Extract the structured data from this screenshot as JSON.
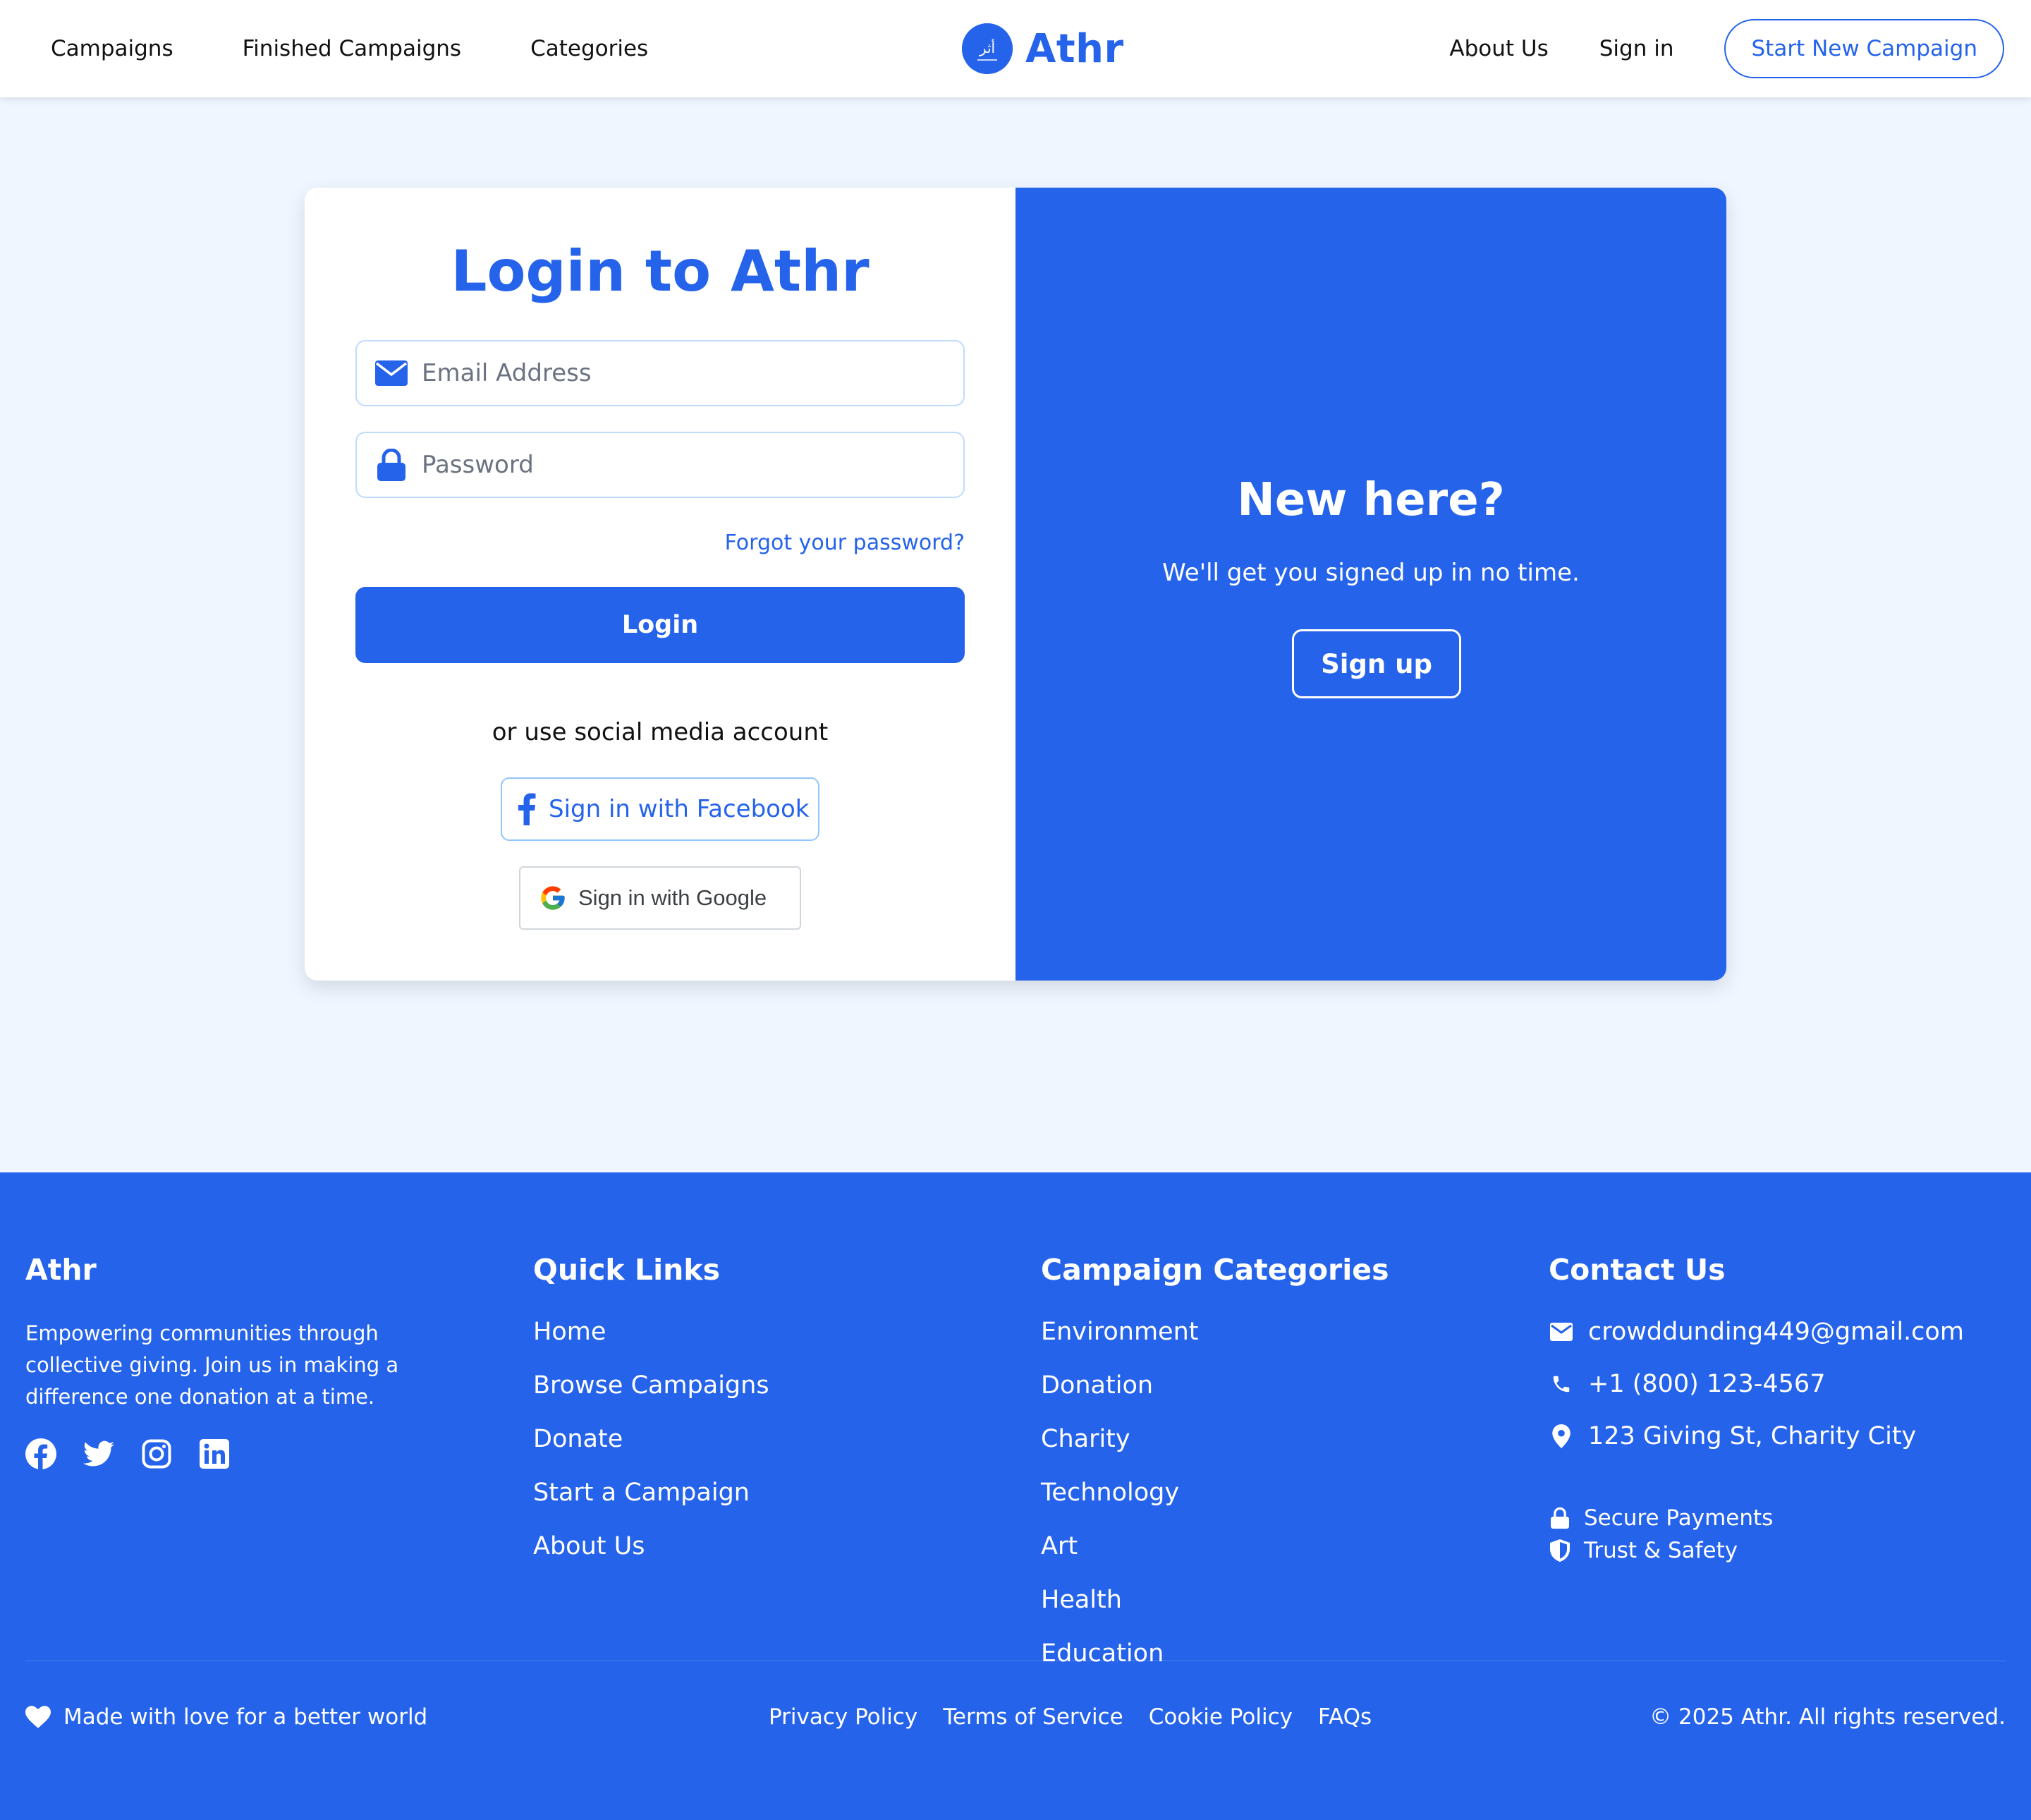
{
  "nav": {
    "links": [
      "Campaigns",
      "Finished Campaigns",
      "Categories"
    ],
    "brand": "Athr",
    "about": "About Us",
    "signin": "Sign in",
    "start_campaign": "Start New Campaign"
  },
  "login": {
    "title": "Login to Athr",
    "email_placeholder": "Email Address",
    "password_placeholder": "Password",
    "forgot": "Forgot your password?",
    "login_button": "Login",
    "social_text": "or use social media account",
    "facebook_button": "Sign in with Facebook",
    "google_button": "Sign in with Google"
  },
  "signup_panel": {
    "title": "New here?",
    "subtitle": "We'll get you signed up in no time.",
    "button": "Sign up"
  },
  "footer": {
    "brand": "Athr",
    "description": "Empowering communities through collective giving. Join us in making a difference one donation at a time.",
    "social_icons": [
      "facebook-icon",
      "twitter-icon",
      "instagram-icon",
      "linkedin-icon"
    ],
    "quick_links_title": "Quick Links",
    "quick_links": [
      "Home",
      "Browse Campaigns",
      "Donate",
      "Start a Campaign",
      "About Us"
    ],
    "categories_title": "Campaign Categories",
    "categories": [
      "Environment",
      "Donation",
      "Charity",
      "Technology",
      "Art",
      "Health",
      "Education"
    ],
    "contact_title": "Contact Us",
    "email": "crowddunding449@gmail.com",
    "phone": "+1 (800) 123-4567",
    "address": "123 Giving St, Charity City",
    "secure": "Secure Payments",
    "trust": "Trust & Safety",
    "made_with": "Made with love for a better world",
    "legal": [
      "Privacy Policy",
      "Terms of Service",
      "Cookie Policy",
      "FAQs"
    ],
    "copyright": "© 2025 Athr. All rights reserved."
  },
  "colors": {
    "primary": "#2563eb",
    "page_bg": "#eff6ff",
    "input_border": "#bfdbfe"
  }
}
